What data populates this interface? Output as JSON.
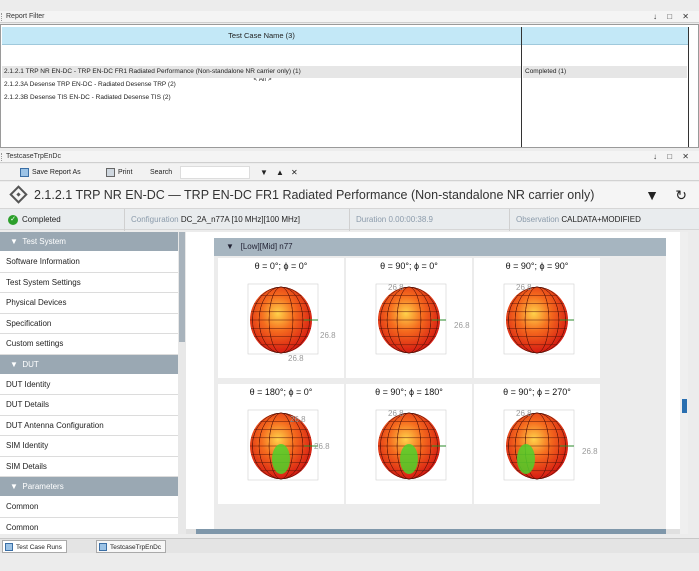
{
  "report_filter": {
    "pane_title": "Report Filter",
    "col_name_header": "Test Case Name (3)",
    "all_row": "< All >",
    "rows": [
      "2.1.2.1 TRP NR EN-DC - TRP EN-DC FR1 Radiated Performance (Non-standalone NR carrier only) (1)",
      "2.1.2.3A Desense TRP EN-DC - Radiated Desense TRP (2)",
      "2.1.2.3B Desense TIS EN-DC - Radiated Desense TIS (2)"
    ],
    "status_row": "Completed (1)"
  },
  "pane_controls": "↓ □ ✕",
  "testcase_pane": {
    "pane_title": "TestcaseTrpEnDc",
    "toolbar": {
      "save_label": "Save Report As",
      "print_label": "Print",
      "search_label": "Search",
      "down_arrow": "▼",
      "up_arrow": "▲",
      "close": "✕"
    },
    "title": "2.1.2.1 TRP NR EN-DC — TRP EN-DC FR1 Radiated Performance (Non-standalone NR carrier only)",
    "filter_icon": "▼",
    "refresh_icon": "↻",
    "status": {
      "state": "Completed",
      "config_label": "Configuration",
      "config_value": "DC_2A_n77A [10 MHz][100 MHz]",
      "duration_label": "Duration",
      "duration_value": "0.00:00:38.9",
      "observation_label": "Observation",
      "observation_value": "CALDATA+MODIFIED"
    },
    "sidebar": {
      "groups": [
        {
          "label": "Test System",
          "items": [
            "Software Information",
            "Test System Settings",
            "Physical Devices",
            "Specification",
            "Custom settings"
          ]
        },
        {
          "label": "DUT",
          "items": [
            "DUT Identity",
            "DUT Details",
            "DUT Antenna Configuration",
            "SIM Identity",
            "SIM Details"
          ]
        },
        {
          "label": "Parameters",
          "items": [
            "Common",
            "Common"
          ]
        }
      ]
    },
    "panel_header": "[Low][Mid] n77",
    "plots": [
      {
        "title": "θ = 0°; ϕ = 0°",
        "labels": [
          "26.8",
          "26.8"
        ]
      },
      {
        "title": "θ = 90°; ϕ = 0°",
        "labels": [
          "26.8",
          "26.8"
        ]
      },
      {
        "title": "θ = 90°; ϕ = 90°",
        "labels": [
          "26.8"
        ]
      },
      {
        "title": "θ = 180°; ϕ = 0°",
        "labels": [
          "26.8",
          "26.8"
        ]
      },
      {
        "title": "θ = 90°; ϕ = 180°",
        "labels": [
          "26.8"
        ]
      },
      {
        "title": "θ = 90°; ϕ = 270°",
        "labels": [
          "26.8",
          "26.8"
        ]
      }
    ],
    "colors": {
      "accent": "#1a7fd0",
      "group_bg": "#9aa8b3",
      "completed": "#2ca02c",
      "header_blue": "#c3e8f7"
    }
  },
  "bottom_tabs": [
    "Test Case Runs",
    "TestcaseTrpEnDc"
  ]
}
